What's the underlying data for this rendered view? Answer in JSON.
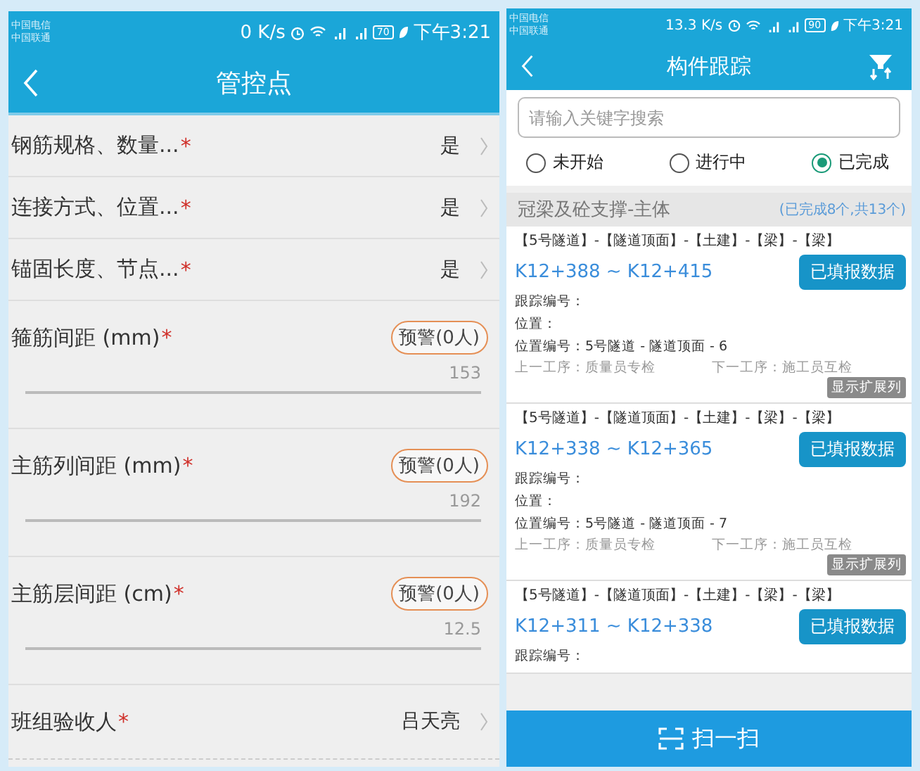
{
  "control_points": {
    "status_bar": {
      "carriers": [
        "中国电信",
        "中国联通"
      ],
      "speed": "0 K/s",
      "battery": "70",
      "time": "下午3:21"
    },
    "title": "管控点",
    "rows": [
      {
        "kind": "select",
        "label": "钢筋规格、数量...",
        "required_mark": "*",
        "value": "是"
      },
      {
        "kind": "select",
        "label": "连接方式、位置...",
        "required_mark": "*",
        "value": "是"
      },
      {
        "kind": "select",
        "label": "锚固长度、节点...",
        "required_mark": "*",
        "value": "是"
      },
      {
        "kind": "measure",
        "label": "箍筋间距 (mm)",
        "required_mark": "*",
        "badge": "预警(0人)",
        "placeholder": "153"
      },
      {
        "kind": "measure",
        "label": "主筋列间距 (mm)",
        "required_mark": "*",
        "badge": "预警(0人)",
        "placeholder": "192"
      },
      {
        "kind": "measure",
        "label": "主筋层间距 (cm)",
        "required_mark": "*",
        "badge": "预警(0人)",
        "placeholder": "12.5"
      },
      {
        "kind": "select",
        "label": "班组验收人",
        "required_mark": "*",
        "value": "吕天亮"
      }
    ]
  },
  "tracking": {
    "status_bar": {
      "carriers": [
        "中国电信",
        "中国联通"
      ],
      "speed": "13.3 K/s",
      "battery": "90",
      "time": "下午3:21"
    },
    "title": "构件跟踪",
    "search": {
      "placeholder": "请输入关键字搜索"
    },
    "filters": [
      {
        "label": "未开始",
        "selected": false
      },
      {
        "label": "进行中",
        "selected": false
      },
      {
        "label": "已完成",
        "selected": true
      }
    ],
    "section": {
      "title": "冠梁及砼支撑-主体",
      "summary": "(已完成8个,共13个)"
    },
    "cards": [
      {
        "path": "【5号隧道】-【隧道顶面】-【土建】-【梁】-【梁】",
        "range": "K12+388 ~ K12+415",
        "button": "已填报数据",
        "fields": [
          "跟踪编号：",
          "位置：",
          "位置编号：5号隧道 - 隧道顶面 - 6"
        ],
        "prev_step": "上一工序：质量员专检",
        "next_step": "下一工序：施工员互检",
        "expand_button": "显示扩展列"
      },
      {
        "path": "【5号隧道】-【隧道顶面】-【土建】-【梁】-【梁】",
        "range": "K12+338 ~ K12+365",
        "button": "已填报数据",
        "fields": [
          "跟踪编号：",
          "位置：",
          "位置编号：5号隧道 - 隧道顶面 - 7"
        ],
        "prev_step": "上一工序：质量员专检",
        "next_step": "下一工序：施工员互检",
        "expand_button": "显示扩展列"
      },
      {
        "path": "【5号隧道】-【隧道顶面】-【土建】-【梁】-【梁】",
        "range": "K12+311 ~ K12+338",
        "button": "已填报数据",
        "fields": [
          "跟踪编号："
        ]
      }
    ],
    "scan_button": "扫一扫"
  }
}
